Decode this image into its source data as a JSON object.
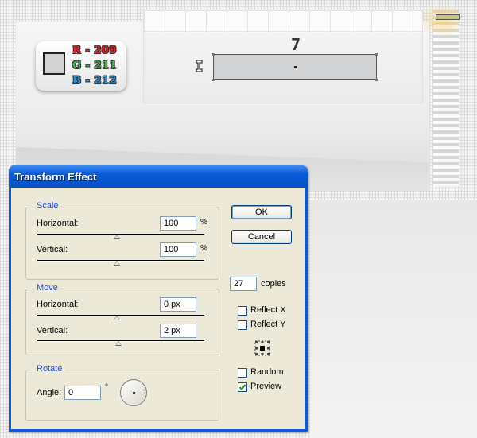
{
  "canvas": {
    "step_number": "7",
    "color_card": {
      "r": "R - 209",
      "g": "G - 211",
      "b": "B - 212",
      "swatch_color": "#d1d3d4"
    }
  },
  "dialog": {
    "title": "Transform Effect",
    "scale": {
      "label": "Scale",
      "horizontal_label": "Horizontal:",
      "horizontal_value": "100",
      "vertical_label": "Vertical:",
      "vertical_value": "100",
      "unit": "%"
    },
    "move": {
      "label": "Move",
      "horizontal_label": "Horizontal:",
      "horizontal_value": "0 px",
      "vertical_label": "Vertical:",
      "vertical_value": "2 px"
    },
    "rotate": {
      "label": "Rotate",
      "angle_label": "Angle:",
      "angle_value": "0",
      "angle_unit": "°"
    },
    "ok_label": "OK",
    "cancel_label": "Cancel",
    "copies_value": "27",
    "copies_label": "copies",
    "reflect_x": {
      "label": "Reflect X",
      "checked": false
    },
    "reflect_y": {
      "label": "Reflect Y",
      "checked": false
    },
    "random": {
      "label": "Random",
      "checked": false
    },
    "preview": {
      "label": "Preview",
      "checked": true
    }
  },
  "colors": {
    "title_bar": "#0a5ad6",
    "dialog_bg": "#ece9d8",
    "group_label": "#1f4fd0",
    "rgb_red": "#ec1c24",
    "rgb_green": "#39b54a",
    "rgb_blue": "#2e8ccf"
  }
}
